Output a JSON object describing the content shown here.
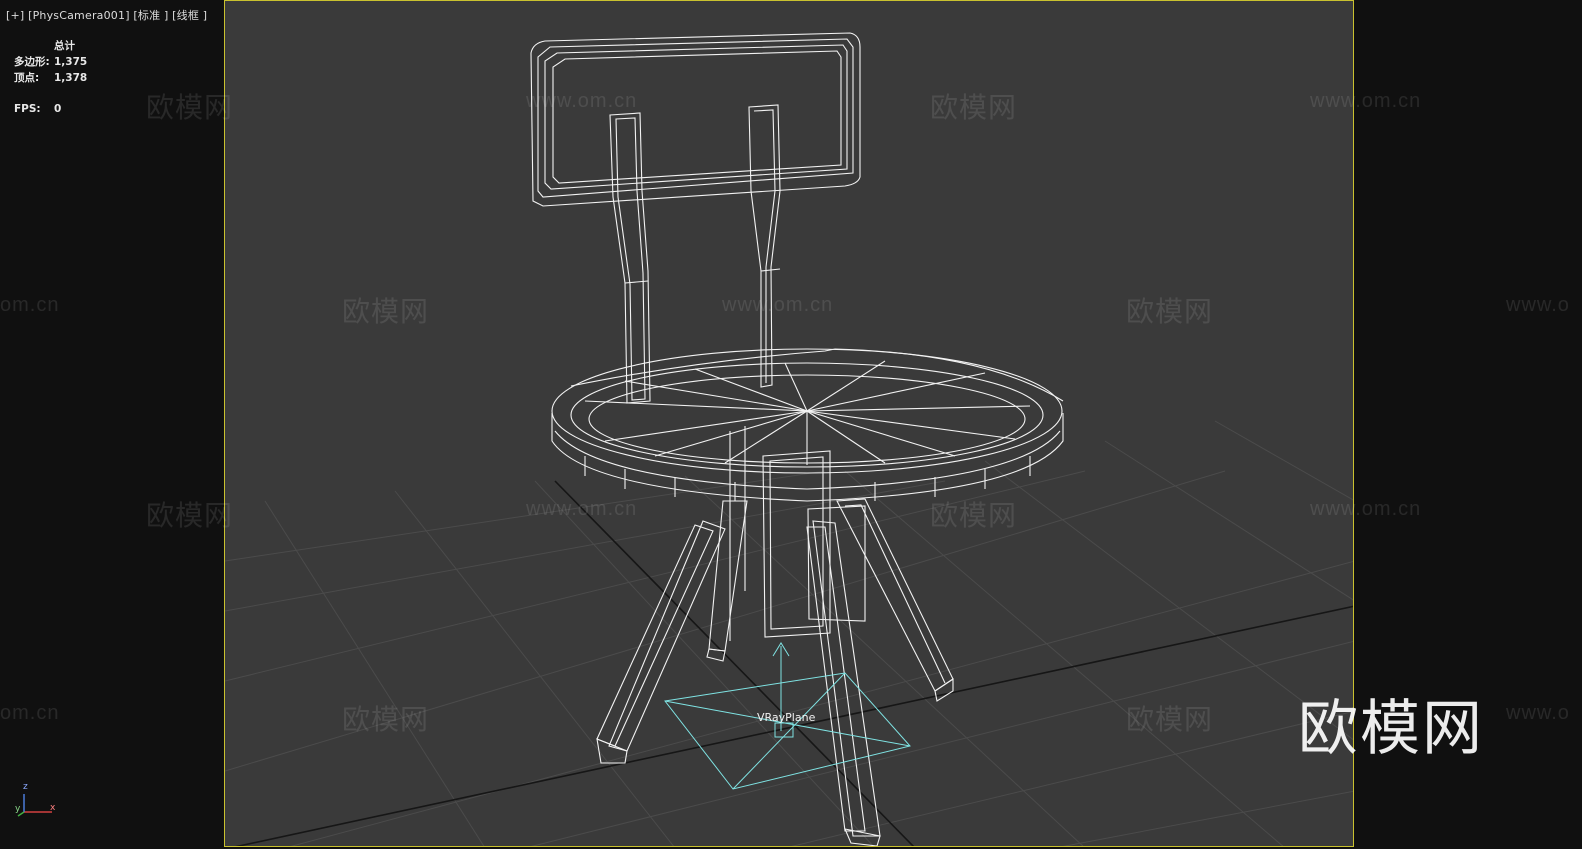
{
  "viewport": {
    "label": "[+] [PhysCamera001] [标准 ] [线框 ]"
  },
  "stats": {
    "header": "总计",
    "polygons_label": "多边形:",
    "polygons_value": "1,375",
    "vertices_label": "顶点:",
    "vertices_value": "1,378",
    "fps_label": "FPS:",
    "fps_value": "0"
  },
  "scene": {
    "helper_label": "VRayPlane",
    "object_color": "#f2f2f2",
    "helper_color": "#7fe3e3",
    "grid_color": "#4b4b4b",
    "viewport_border_color": "#c9c12f"
  },
  "axes": {
    "x": "x",
    "y": "y",
    "z": "z"
  },
  "watermarks": {
    "text_cn": "欧模网",
    "text_url": "www.om.cn",
    "text_url_partial_left": "om.cn",
    "text_url_partial_right": "www.o"
  },
  "logo": {
    "text": "欧模网"
  }
}
